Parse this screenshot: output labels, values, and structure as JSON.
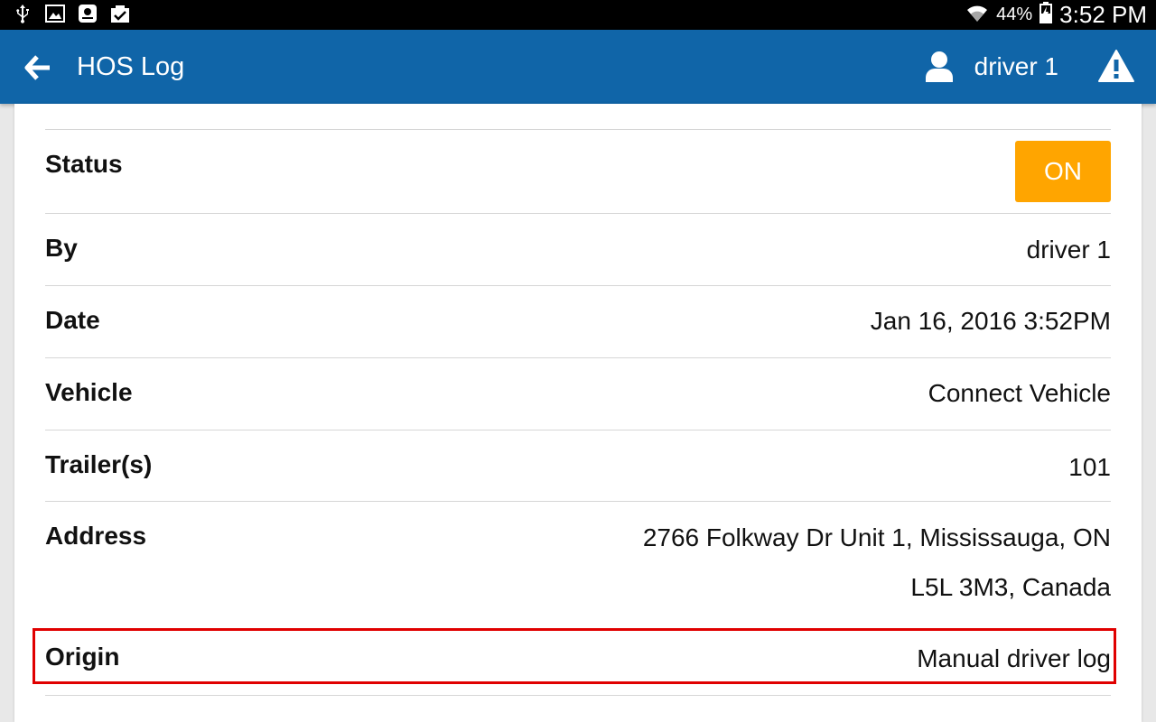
{
  "status_bar": {
    "icons": [
      "usb-icon",
      "image-icon",
      "galaxy-icon",
      "clipboard-check-icon"
    ],
    "battery_percent": "44%",
    "time": "3:52 PM"
  },
  "appbar": {
    "back_icon": "arrow-left-icon",
    "title": "HOS Log",
    "user_icon": "user-icon",
    "user_name": "driver 1",
    "warning_icon": "warning-icon",
    "color": "#1065a8"
  },
  "details": {
    "status": {
      "label": "Status",
      "value": "ON",
      "color": "#ffa500"
    },
    "by": {
      "label": "By",
      "value": "driver 1"
    },
    "date": {
      "label": "Date",
      "value": "Jan 16, 2016 3:52PM"
    },
    "vehicle": {
      "label": "Vehicle",
      "value": "Connect Vehicle"
    },
    "trailers": {
      "label": "Trailer(s)",
      "value": "101"
    },
    "address": {
      "label": "Address",
      "line1": "2766 Folkway Dr Unit 1, Mississauga, ON",
      "line2": "L5L 3M3, Canada"
    },
    "origin": {
      "label": "Origin",
      "value": "Manual driver log"
    }
  },
  "highlight_color": "#e00000"
}
